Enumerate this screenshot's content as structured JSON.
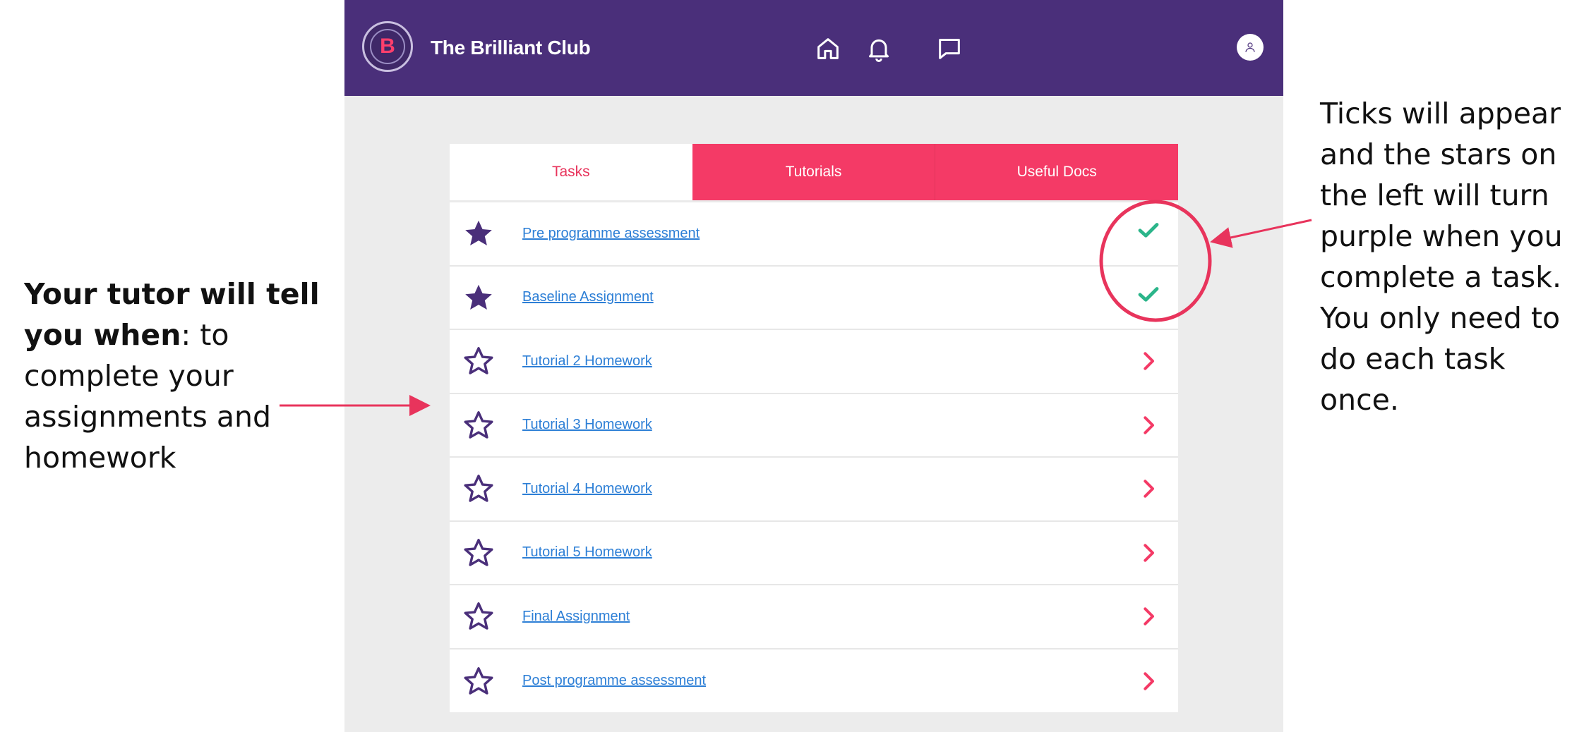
{
  "app": {
    "title": "The Brilliant Club",
    "logo_letter": "B",
    "colors": {
      "header": "#4a2f7a",
      "accent": "#f43a66",
      "link": "#2d7fd6",
      "tick": "#2bb58a",
      "star": "#4a2f7a"
    },
    "header_icons": [
      "home-icon",
      "bell-icon",
      "message-icon",
      "user-avatar-icon"
    ]
  },
  "tabs": [
    {
      "label": "Tasks",
      "active": true
    },
    {
      "label": "Tutorials",
      "active": false
    },
    {
      "label": "Useful Docs",
      "active": false
    }
  ],
  "tasks": [
    {
      "label": "Pre programme assessment",
      "completed": true,
      "status_icon": "check-icon"
    },
    {
      "label": "Baseline Assignment",
      "completed": true,
      "status_icon": "check-icon"
    },
    {
      "label": "Tutorial 2 Homework",
      "completed": false,
      "status_icon": "chevron-right-icon"
    },
    {
      "label": "Tutorial 3 Homework",
      "completed": false,
      "status_icon": "chevron-right-icon"
    },
    {
      "label": "Tutorial 4 Homework",
      "completed": false,
      "status_icon": "chevron-right-icon"
    },
    {
      "label": "Tutorial 5 Homework",
      "completed": false,
      "status_icon": "chevron-right-icon"
    },
    {
      "label": "Final Assignment",
      "completed": false,
      "status_icon": "chevron-right-icon"
    },
    {
      "label": "Post programme assessment",
      "completed": false,
      "status_icon": "chevron-right-icon"
    }
  ],
  "annotations": {
    "left_bold": "Your tutor will tell you when",
    "left_rest": ": to complete your assignments and homework",
    "right": "Ticks will appear and the stars on the left will turn purple when you complete a task. You only need to do each task once.",
    "arrow_color": "#e8345c"
  }
}
